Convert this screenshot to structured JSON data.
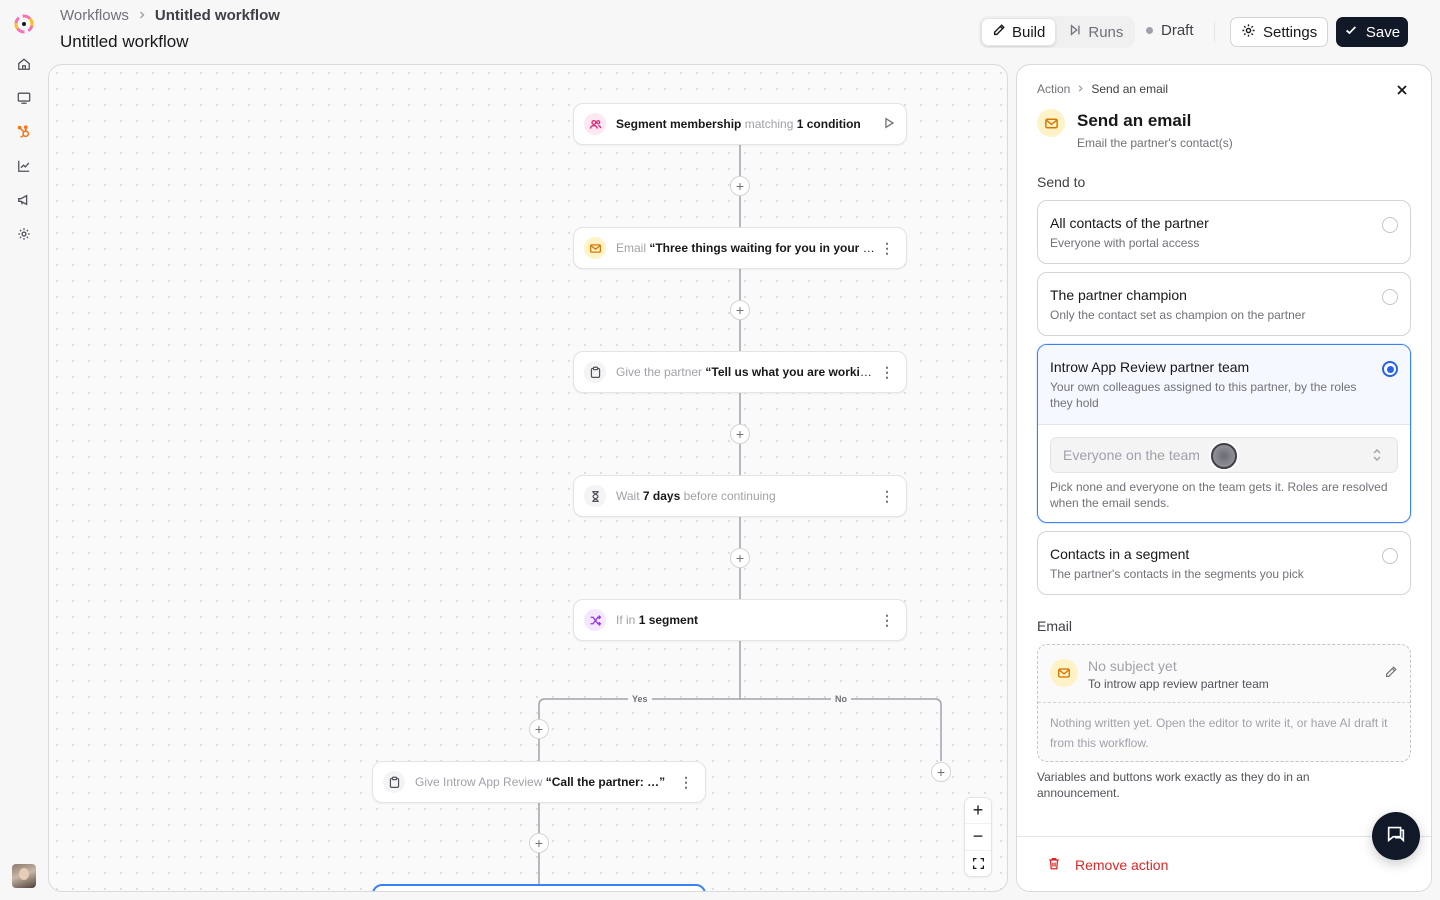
{
  "header": {
    "breadcrumb_root": "Workflows",
    "breadcrumb_current": "Untitled workflow",
    "title": "Untitled workflow",
    "tabs": [
      {
        "label": "Build",
        "icon": "pencil-icon",
        "active": true
      },
      {
        "label": "Runs",
        "icon": "play-skip-icon",
        "active": false
      }
    ],
    "status": "Draft",
    "settings_label": "Settings",
    "save_label": "Save"
  },
  "sidebar": {
    "items": [
      {
        "name": "home",
        "icon": "home-icon"
      },
      {
        "name": "monitor",
        "icon": "monitor-icon"
      },
      {
        "name": "hubspot",
        "icon": "hubspot-icon",
        "accent": "#f97316"
      },
      {
        "name": "analytics",
        "icon": "chart-icon"
      },
      {
        "name": "announcements",
        "icon": "megaphone-icon"
      },
      {
        "name": "settings",
        "icon": "gear-icon"
      }
    ]
  },
  "workflow": {
    "nodes": [
      {
        "id": "trigger",
        "icon": "users-icon",
        "parts": [
          {
            "text": "Segment membership",
            "style": "strong"
          },
          {
            "text": " matching ",
            "style": "muted"
          },
          {
            "text": "1 condition",
            "style": "strong"
          }
        ],
        "trailing": "play-icon"
      },
      {
        "id": "email",
        "icon": "mail-icon",
        "parts": [
          {
            "text": "Email ",
            "style": "muted"
          },
          {
            "text": "“Three things waiting for you in your portal”",
            "style": "strong"
          }
        ],
        "trailing": "kebab-icon"
      },
      {
        "id": "task-partner",
        "icon": "clipboard-icon",
        "parts": [
          {
            "text": "Give the partner ",
            "style": "muted"
          },
          {
            "text": "“Tell us what you are working on”",
            "style": "strong"
          }
        ],
        "trailing": "kebab-icon"
      },
      {
        "id": "wait",
        "icon": "hourglass-icon",
        "parts": [
          {
            "text": "Wait ",
            "style": "muted"
          },
          {
            "text": "7 days",
            "style": "strong"
          },
          {
            "text": " before continuing",
            "style": "muted"
          }
        ],
        "trailing": "kebab-icon"
      },
      {
        "id": "branch",
        "icon": "shuffle-icon",
        "parts": [
          {
            "text": "If in ",
            "style": "muted"
          },
          {
            "text": "1 segment",
            "style": "strong"
          }
        ],
        "trailing": "kebab-icon"
      },
      {
        "id": "task-team",
        "icon": "clipboard-icon",
        "parts": [
          {
            "text": "Give Introw App Review ",
            "style": "muted"
          },
          {
            "text": "“Call the partner: …”",
            "style": "strong"
          }
        ],
        "trailing": "kebab-icon"
      }
    ],
    "branch_yes": "Yes",
    "branch_no": "No",
    "add_step_symbol": "+",
    "zoom_in": "+",
    "zoom_out": "−"
  },
  "panel": {
    "breadcrumb_root": "Action",
    "breadcrumb_current": "Send an email",
    "title": "Send an email",
    "subtitle": "Email the partner's contact(s)",
    "send_to_label": "Send to",
    "options": [
      {
        "title": "All contacts of the partner",
        "desc": "Everyone with portal access",
        "selected": false
      },
      {
        "title": "The partner champion",
        "desc": "Only the contact set as champion on the partner",
        "selected": false
      },
      {
        "title": "Introw App Review partner team",
        "desc": "Your own colleagues assigned to this partner, by the roles they hold",
        "selected": true
      },
      {
        "title": "Contacts in a segment",
        "desc": "The partner's contacts in the segments you pick",
        "selected": false
      }
    ],
    "team_select_placeholder": "Everyone on the team",
    "team_help": "Pick none and everyone on the team gets it. Roles are resolved when the email sends.",
    "email_label": "Email",
    "email_subject": "No subject yet",
    "email_to": "To introw app review partner team",
    "email_body": "Nothing written yet. Open the editor to write it, or have AI draft it from this workflow.",
    "vars_note": "Variables and buttons work exactly as they do in an announcement.",
    "remove_label": "Remove action"
  },
  "colors": {
    "accent_blue": "#2563eb",
    "danger": "#dc2626",
    "email_icon_bg": "#fef3c7",
    "trigger_icon": "#db2777",
    "branch_icon": "#9333ea",
    "save_bg": "#111827"
  }
}
